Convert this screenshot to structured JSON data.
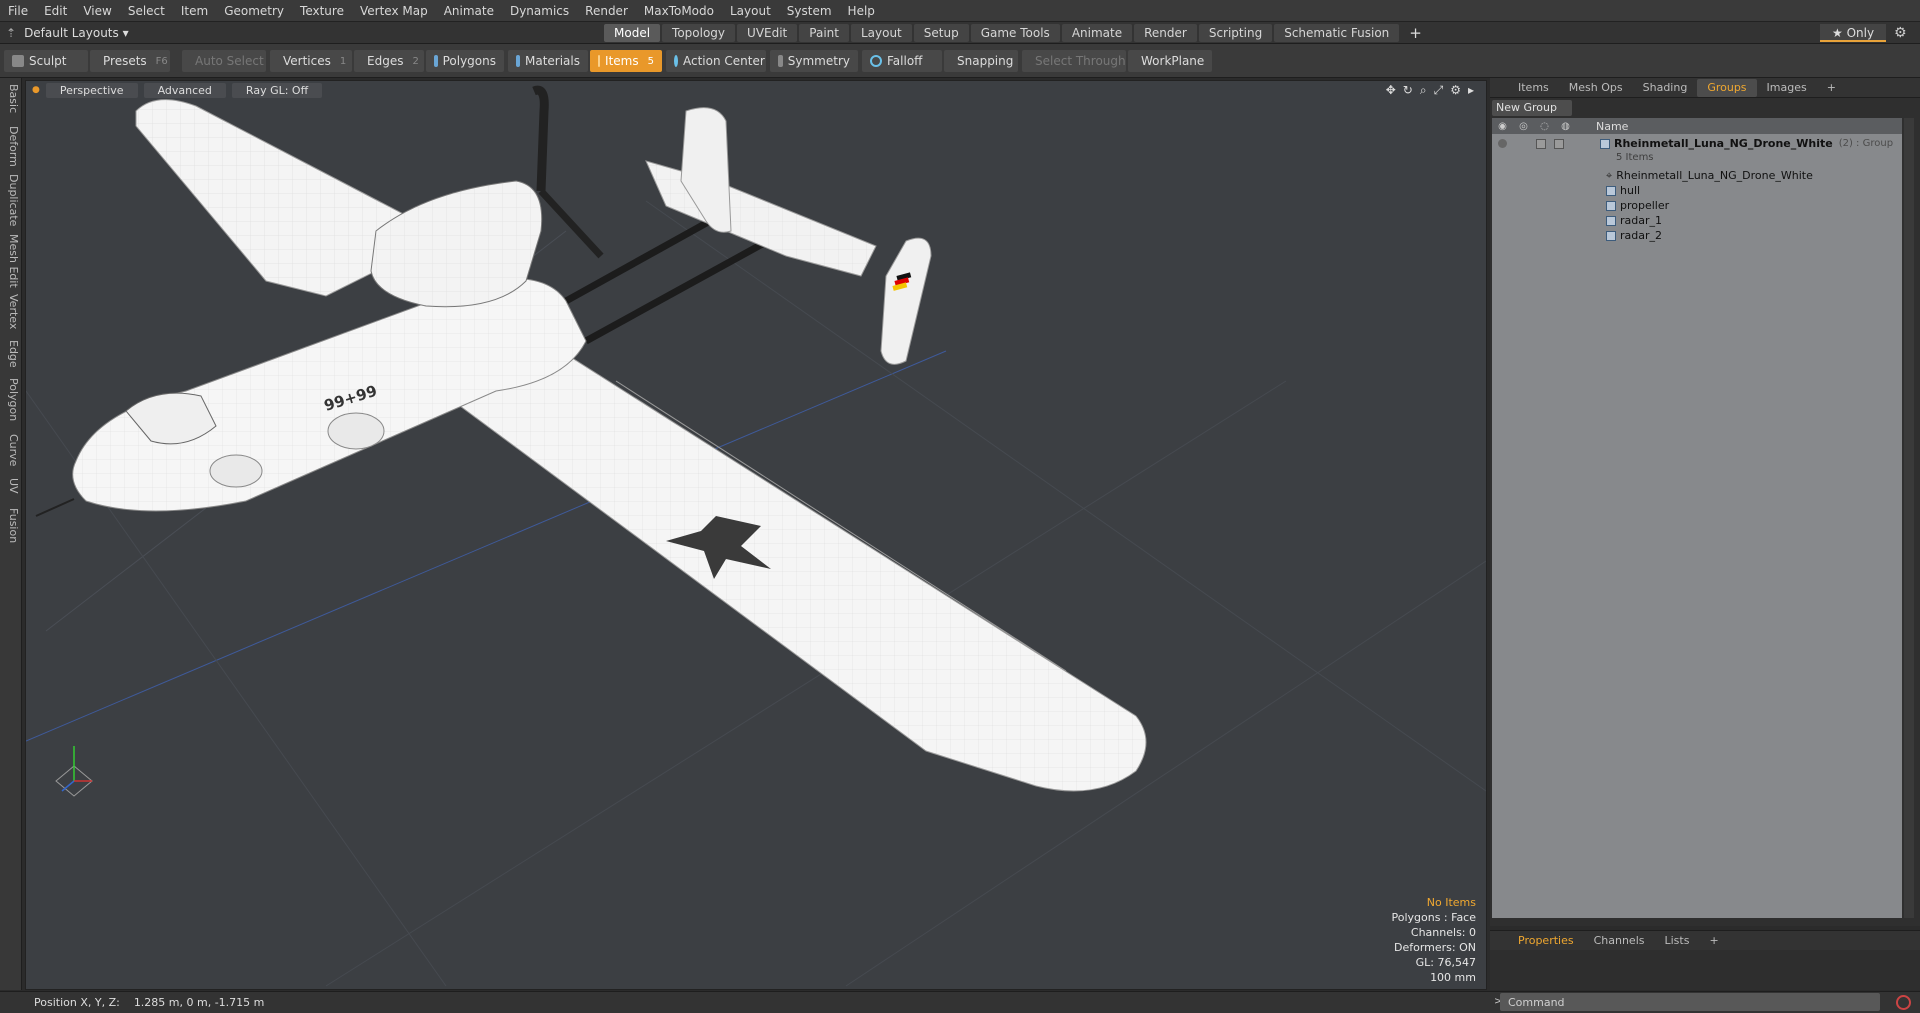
{
  "menu": [
    "File",
    "Edit",
    "View",
    "Select",
    "Item",
    "Geometry",
    "Texture",
    "Vertex Map",
    "Animate",
    "Dynamics",
    "Render",
    "MaxToModo",
    "Layout",
    "System",
    "Help"
  ],
  "layouts": {
    "label": "Default Layouts ▾"
  },
  "mode_tabs": [
    "Model",
    "Topology",
    "UVEdit",
    "Paint",
    "Layout",
    "Setup",
    "Game Tools",
    "Animate",
    "Render",
    "Scripting",
    "Schematic Fusion"
  ],
  "active_mode": "Model",
  "only": "★ Only",
  "tools": {
    "sculpt": "Sculpt",
    "presets": "Presets",
    "presets_key": "F6",
    "auto_select": "Auto Select",
    "vertices": "Vertices",
    "vertices_key": "1",
    "edges": "Edges",
    "edges_key": "2",
    "polygons": "Polygons",
    "materials": "Materials",
    "items": "Items",
    "items_key": "5",
    "action_center": "Action Center",
    "symmetry": "Symmetry",
    "falloff": "Falloff",
    "snapping": "Snapping",
    "select_through": "Select Through",
    "workplane": "WorkPlane"
  },
  "left_tabs": [
    "Basic",
    "Deform",
    "Duplicate",
    "Mesh Edit",
    "Vertex",
    "Edge",
    "Polygon",
    "Curve",
    "UV",
    "Fusion"
  ],
  "viewport": {
    "view": "Perspective",
    "shading": "Advanced",
    "raygl": "Ray GL: Off",
    "wing_code": "99+99",
    "info": {
      "line1": "No Items",
      "line2": "Polygons : Face",
      "line3": "Channels: 0",
      "line4": "Deformers: ON",
      "line5": "GL: 76,547",
      "line6": "100 mm"
    }
  },
  "right_tabs": [
    "Items",
    "Mesh Ops",
    "Shading",
    "Groups",
    "Images"
  ],
  "active_right_tab": "Groups",
  "new_group": "New Group",
  "tree": {
    "col_name": "Name",
    "group_name": "Rheinmetall_Luna_NG_Drone_White",
    "group_count": "(2) : Group",
    "group_items": "5 Items",
    "children": [
      "Rheinmetall_Luna_NG_Drone_White",
      "hull",
      "propeller",
      "radar_1",
      "radar_2"
    ]
  },
  "bottom_tabs": [
    "Properties",
    "Channels",
    "Lists"
  ],
  "active_bottom_tab": "Properties",
  "status": {
    "label": "Position X, Y, Z:",
    "value": "1.285 m, 0 m, -1.715 m"
  },
  "command": {
    "placeholder": "Command"
  },
  "colors": {
    "accent": "#e9982a",
    "viewport": "#3c3f43",
    "tree_bg": "#87898c"
  }
}
